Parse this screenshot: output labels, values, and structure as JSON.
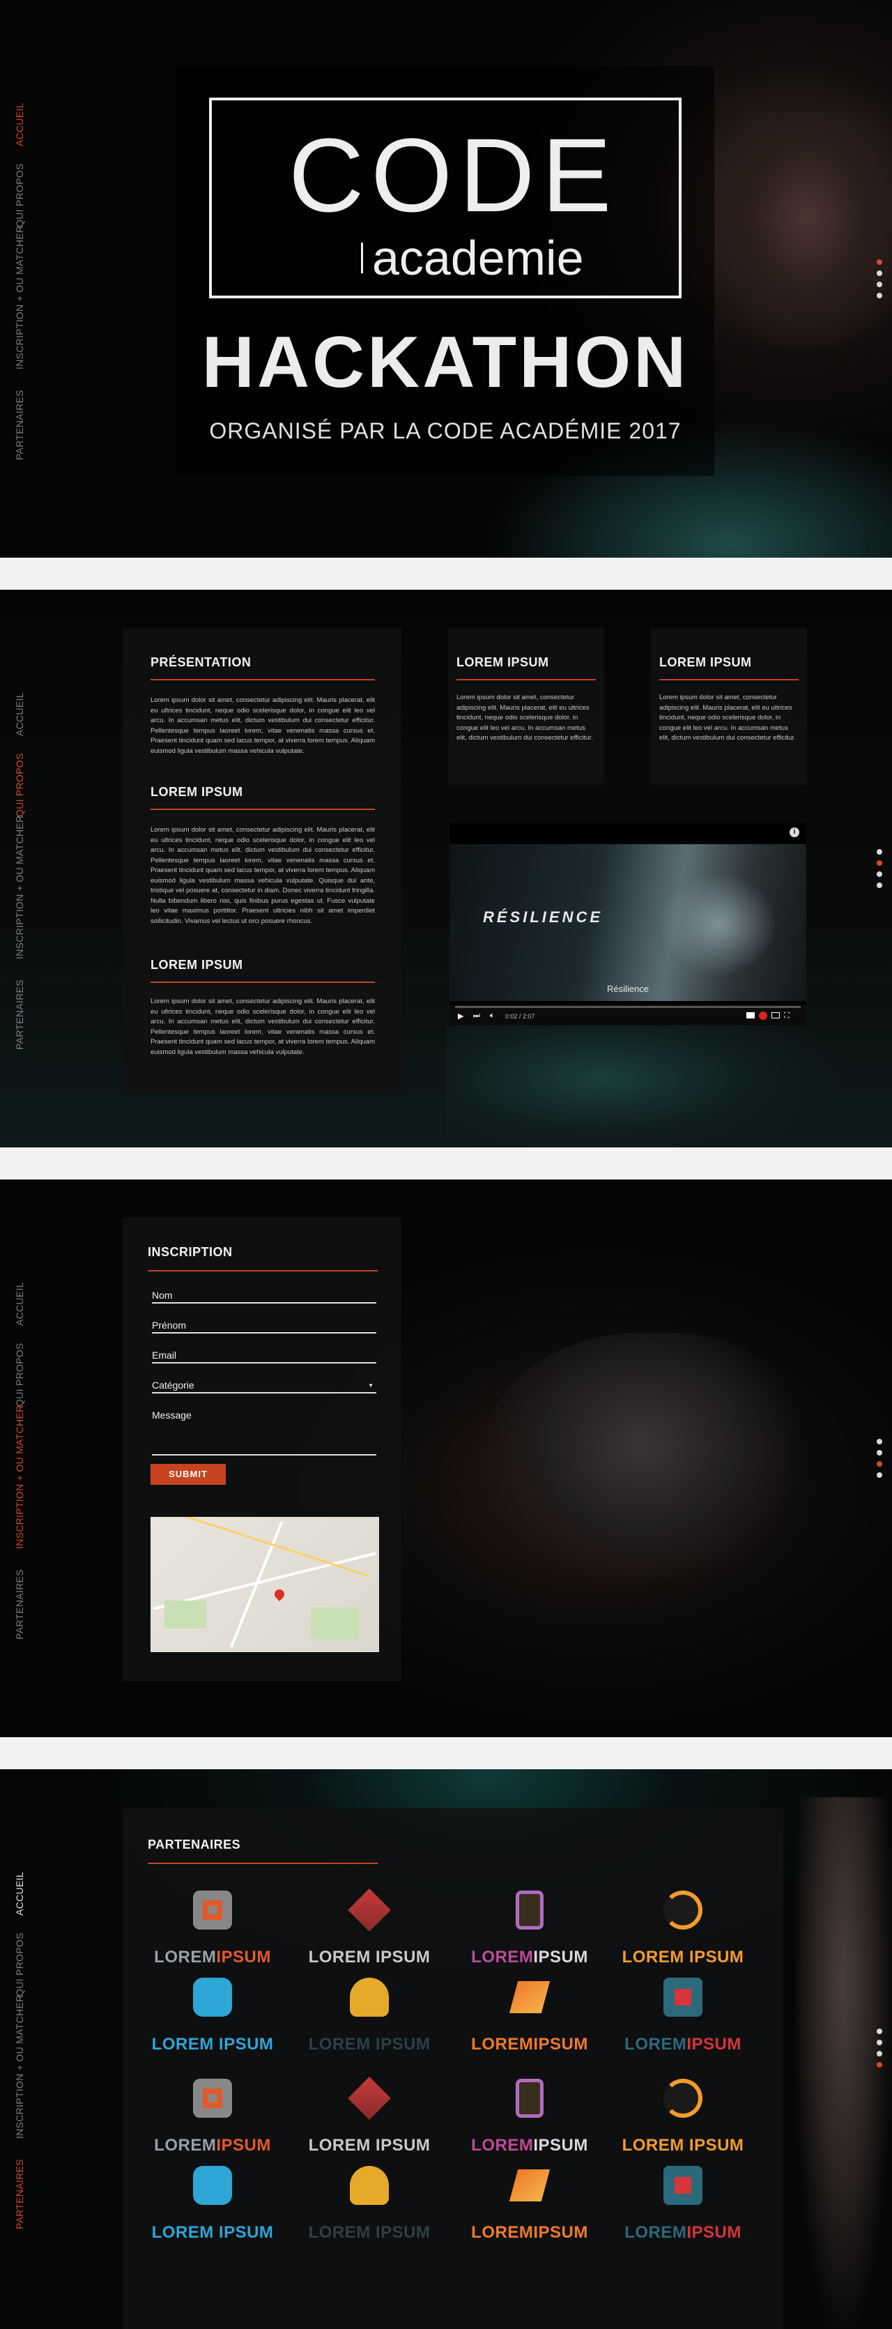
{
  "nav": {
    "accueil": "ACCUEIL",
    "qui_propos": "QUI PROPOS",
    "inscription": "INSCRIPTION + OU MATCHER",
    "partenaires": "PARTENAIRES",
    "partenaires_s2": "PARTENAIRES"
  },
  "hero": {
    "logo_code": "CODE",
    "logo_academie": "academie",
    "title": "HACKATHON",
    "subtitle": "ORGANISÉ PAR LA CODE ACADÉMIE 2017"
  },
  "about": {
    "presentation_title": "PRÉSENTATION",
    "presentation_text": "Lorem ipsum dolor sit amet, consectetur adipiscing elit. Mauris placerat, elit eu ultrices tincidunt, neque odio scelerisque dolor, in congue elit leo vel arcu. In accumsan metus elit, dictum vestibulum dui consectetur efficitur. Pellentesque tempus laoreet lorem, vitae venenatis massa cursus et. Praesent tincidunt quam sed lacus tempor, at viverra lorem tempus. Aliquam euismod ligula vestibulum massa vehicula vulputate.",
    "lorem1_title": "LOREM IPSUM",
    "lorem1_text": "Lorem ipsum dolor sit amet, consectetur adipiscing elit. Mauris placerat, elit eu ultrices tincidunt, neque odio scelerisque dolor, in congue elit leo vel arcu. In accumsan metus elit, dictum vestibulum dui consectetur efficitur. Pellentesque tempus laoreet lorem, vitae venenatis massa cursus et. Praesent tincidunt quam sed lacus tempor, at viverra lorem tempus. Aliquam euismod ligula vestibulum massa vehicula vulputate. Quisque dui ante, tristique vel posuere at, consectetur in diam. Donec viverra tincidunt fringilla. Nulla bibendum libero nisi, quis finibus purus egestas ut. Fusce vulputate leo vitae maximus porttitor. Praesent ultricies nibh sit amet imperdiet sollicitudin. Vivamus vel lectus ut orci posuere rhoncus.",
    "lorem2_title": "LOREM IPSUM",
    "lorem2_text": "Lorem ipsum dolor sit amet, consectetur adipiscing elit. Mauris placerat, elit eu ultrices tincidunt, neque odio scelerisque dolor, in congue elit leo vel arcu. In accumsan metus elit, dictum vestibulum dui consectetur efficitur. Pellentesque tempus laoreet lorem, vitae venenatis massa cursus et. Praesent tincidunt quam sed lacus tempor, at viverra lorem tempus. Aliquam euismod ligula vestibulum massa vehicula vulputate.",
    "card1_title": "LOREM IPSUM",
    "card1_text": "Lorem ipsum dolor sit amet, consectetur adipiscing elit. Mauris placerat, elit eu ultrices tincidunt, neque odio scelerisque dolor, in congue elit leo vel arcu. In accumsan metus elit, dictum vestibulum dui consectetur efficitur.",
    "card2_title": "LOREM IPSUM",
    "card2_text": "Lorem ipsum dolor sit amet, consectetur adipiscing elit. Mauris placerat, elit eu ultrices tincidunt, neque odio scelerisque dolor, in congue elit leo vel arcu. In accumsan metus elit, dictum vestibulum dui consectetur efficitur.",
    "video_overlay": "RÉSILIENCE",
    "video_caption": "Résilience",
    "video_time": "0:02 / 2:07"
  },
  "inscription": {
    "title": "INSCRIPTION",
    "nom": "Nom",
    "prenom": "Prénom",
    "email": "Email",
    "categorie": "Catégorie",
    "message": "Message",
    "submit": "SUBMIT"
  },
  "partners": {
    "title": "PARTENAIRES",
    "logos": [
      {
        "text": "LOREMIPSUM",
        "a": "LOREM",
        "b": "IPSUM"
      },
      {
        "text": "LOREM IPSUM"
      },
      {
        "text": "LOREMIPSUM",
        "a": "LOREM",
        "b": "IPSUM"
      },
      {
        "text": "LOREM IPSUM"
      },
      {
        "text": "LOREM IPSUM"
      },
      {
        "text": "LOREM IPSUM"
      },
      {
        "text": "LOREMIPSUM"
      },
      {
        "text": "LOREMIPSUM",
        "a": "LOREM",
        "b": "IPSUM"
      }
    ]
  },
  "colors": {
    "accent": "#c8431f",
    "bg": "#070808",
    "text": "#f0f0f0"
  }
}
